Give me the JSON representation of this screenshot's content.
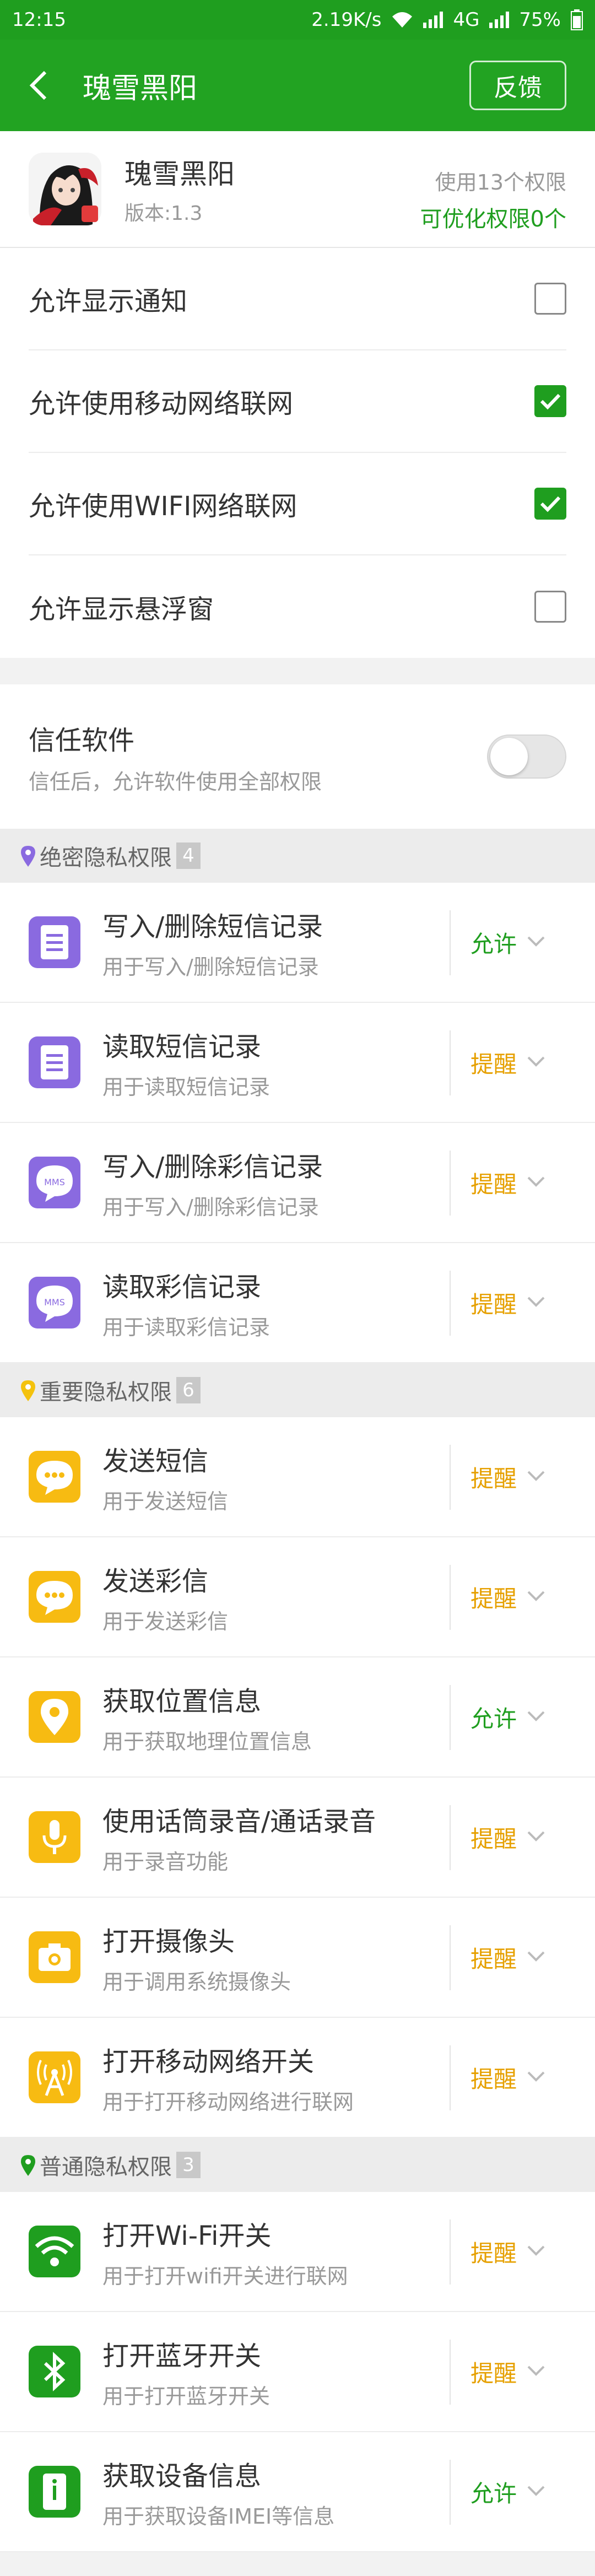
{
  "status": {
    "time": "12:15",
    "speed": "2.19K/s",
    "network": "4G",
    "battery": "75%"
  },
  "appbar": {
    "title": "瑰雪黑阳",
    "feedback": "反馈"
  },
  "app": {
    "name": "瑰雪黑阳",
    "version": "版本:1.3",
    "used": "使用13个权限",
    "optimizable": "可优化权限0个"
  },
  "toggles": [
    {
      "label": "允许显示通知",
      "checked": false
    },
    {
      "label": "允许使用移动网络联网",
      "checked": true
    },
    {
      "label": "允许使用WIFI网络联网",
      "checked": true
    },
    {
      "label": "允许显示悬浮窗",
      "checked": false
    }
  ],
  "trust": {
    "title": "信任软件",
    "desc": "信任后，允许软件使用全部权限",
    "on": false
  },
  "sections": [
    {
      "title": "绝密隐私权限",
      "count": "4",
      "pin_color": "#8a6ae0",
      "items": [
        {
          "title": "写入/删除短信记录",
          "desc": "用于写入/删除短信记录",
          "state": "允许",
          "kind": "allow",
          "icon": "document-icon",
          "color": "#8a6ae0"
        },
        {
          "title": "读取短信记录",
          "desc": "用于读取短信记录",
          "state": "提醒",
          "kind": "remind",
          "icon": "document-icon",
          "color": "#8a6ae0"
        },
        {
          "title": "写入/删除彩信记录",
          "desc": "用于写入/删除彩信记录",
          "state": "提醒",
          "kind": "remind",
          "icon": "mms-icon",
          "color": "#8a6ae0"
        },
        {
          "title": "读取彩信记录",
          "desc": "用于读取彩信记录",
          "state": "提醒",
          "kind": "remind",
          "icon": "mms-icon",
          "color": "#8a6ae0"
        }
      ]
    },
    {
      "title": "重要隐私权限",
      "count": "6",
      "pin_color": "#f4c20d",
      "items": [
        {
          "title": "发送短信",
          "desc": "用于发送短信",
          "state": "提醒",
          "kind": "remind",
          "icon": "chat-icon",
          "color": "#f7bb12"
        },
        {
          "title": "发送彩信",
          "desc": "用于发送彩信",
          "state": "提醒",
          "kind": "remind",
          "icon": "chat-icon",
          "color": "#f7bb12"
        },
        {
          "title": "获取位置信息",
          "desc": "用于获取地理位置信息",
          "state": "允许",
          "kind": "allow",
          "icon": "location-icon",
          "color": "#f7bb12"
        },
        {
          "title": "使用话筒录音/通话录音",
          "desc": "用于录音功能",
          "state": "提醒",
          "kind": "remind",
          "icon": "microphone-icon",
          "color": "#f7bb12"
        },
        {
          "title": "打开摄像头",
          "desc": "用于调用系统摄像头",
          "state": "提醒",
          "kind": "remind",
          "icon": "camera-icon",
          "color": "#f7bb12"
        },
        {
          "title": "打开移动网络开关",
          "desc": "用于打开移动网络进行联网",
          "state": "提醒",
          "kind": "remind",
          "icon": "antenna-icon",
          "color": "#f7bb12"
        }
      ]
    },
    {
      "title": "普通隐私权限",
      "count": "3",
      "pin_color": "#1f9e1f",
      "items": [
        {
          "title": "打开Wi-Fi开关",
          "desc": "用于打开wifi开关进行联网",
          "state": "提醒",
          "kind": "remind",
          "icon": "wifi-icon",
          "color": "#1f9e1f"
        },
        {
          "title": "打开蓝牙开关",
          "desc": "用于打开蓝牙开关",
          "state": "提醒",
          "kind": "remind",
          "icon": "bluetooth-icon",
          "color": "#1f9e1f"
        },
        {
          "title": "获取设备信息",
          "desc": "用于获取设备IMEI等信息",
          "state": "允许",
          "kind": "allow",
          "icon": "device-info-icon",
          "color": "#1f9e1f"
        }
      ]
    }
  ]
}
